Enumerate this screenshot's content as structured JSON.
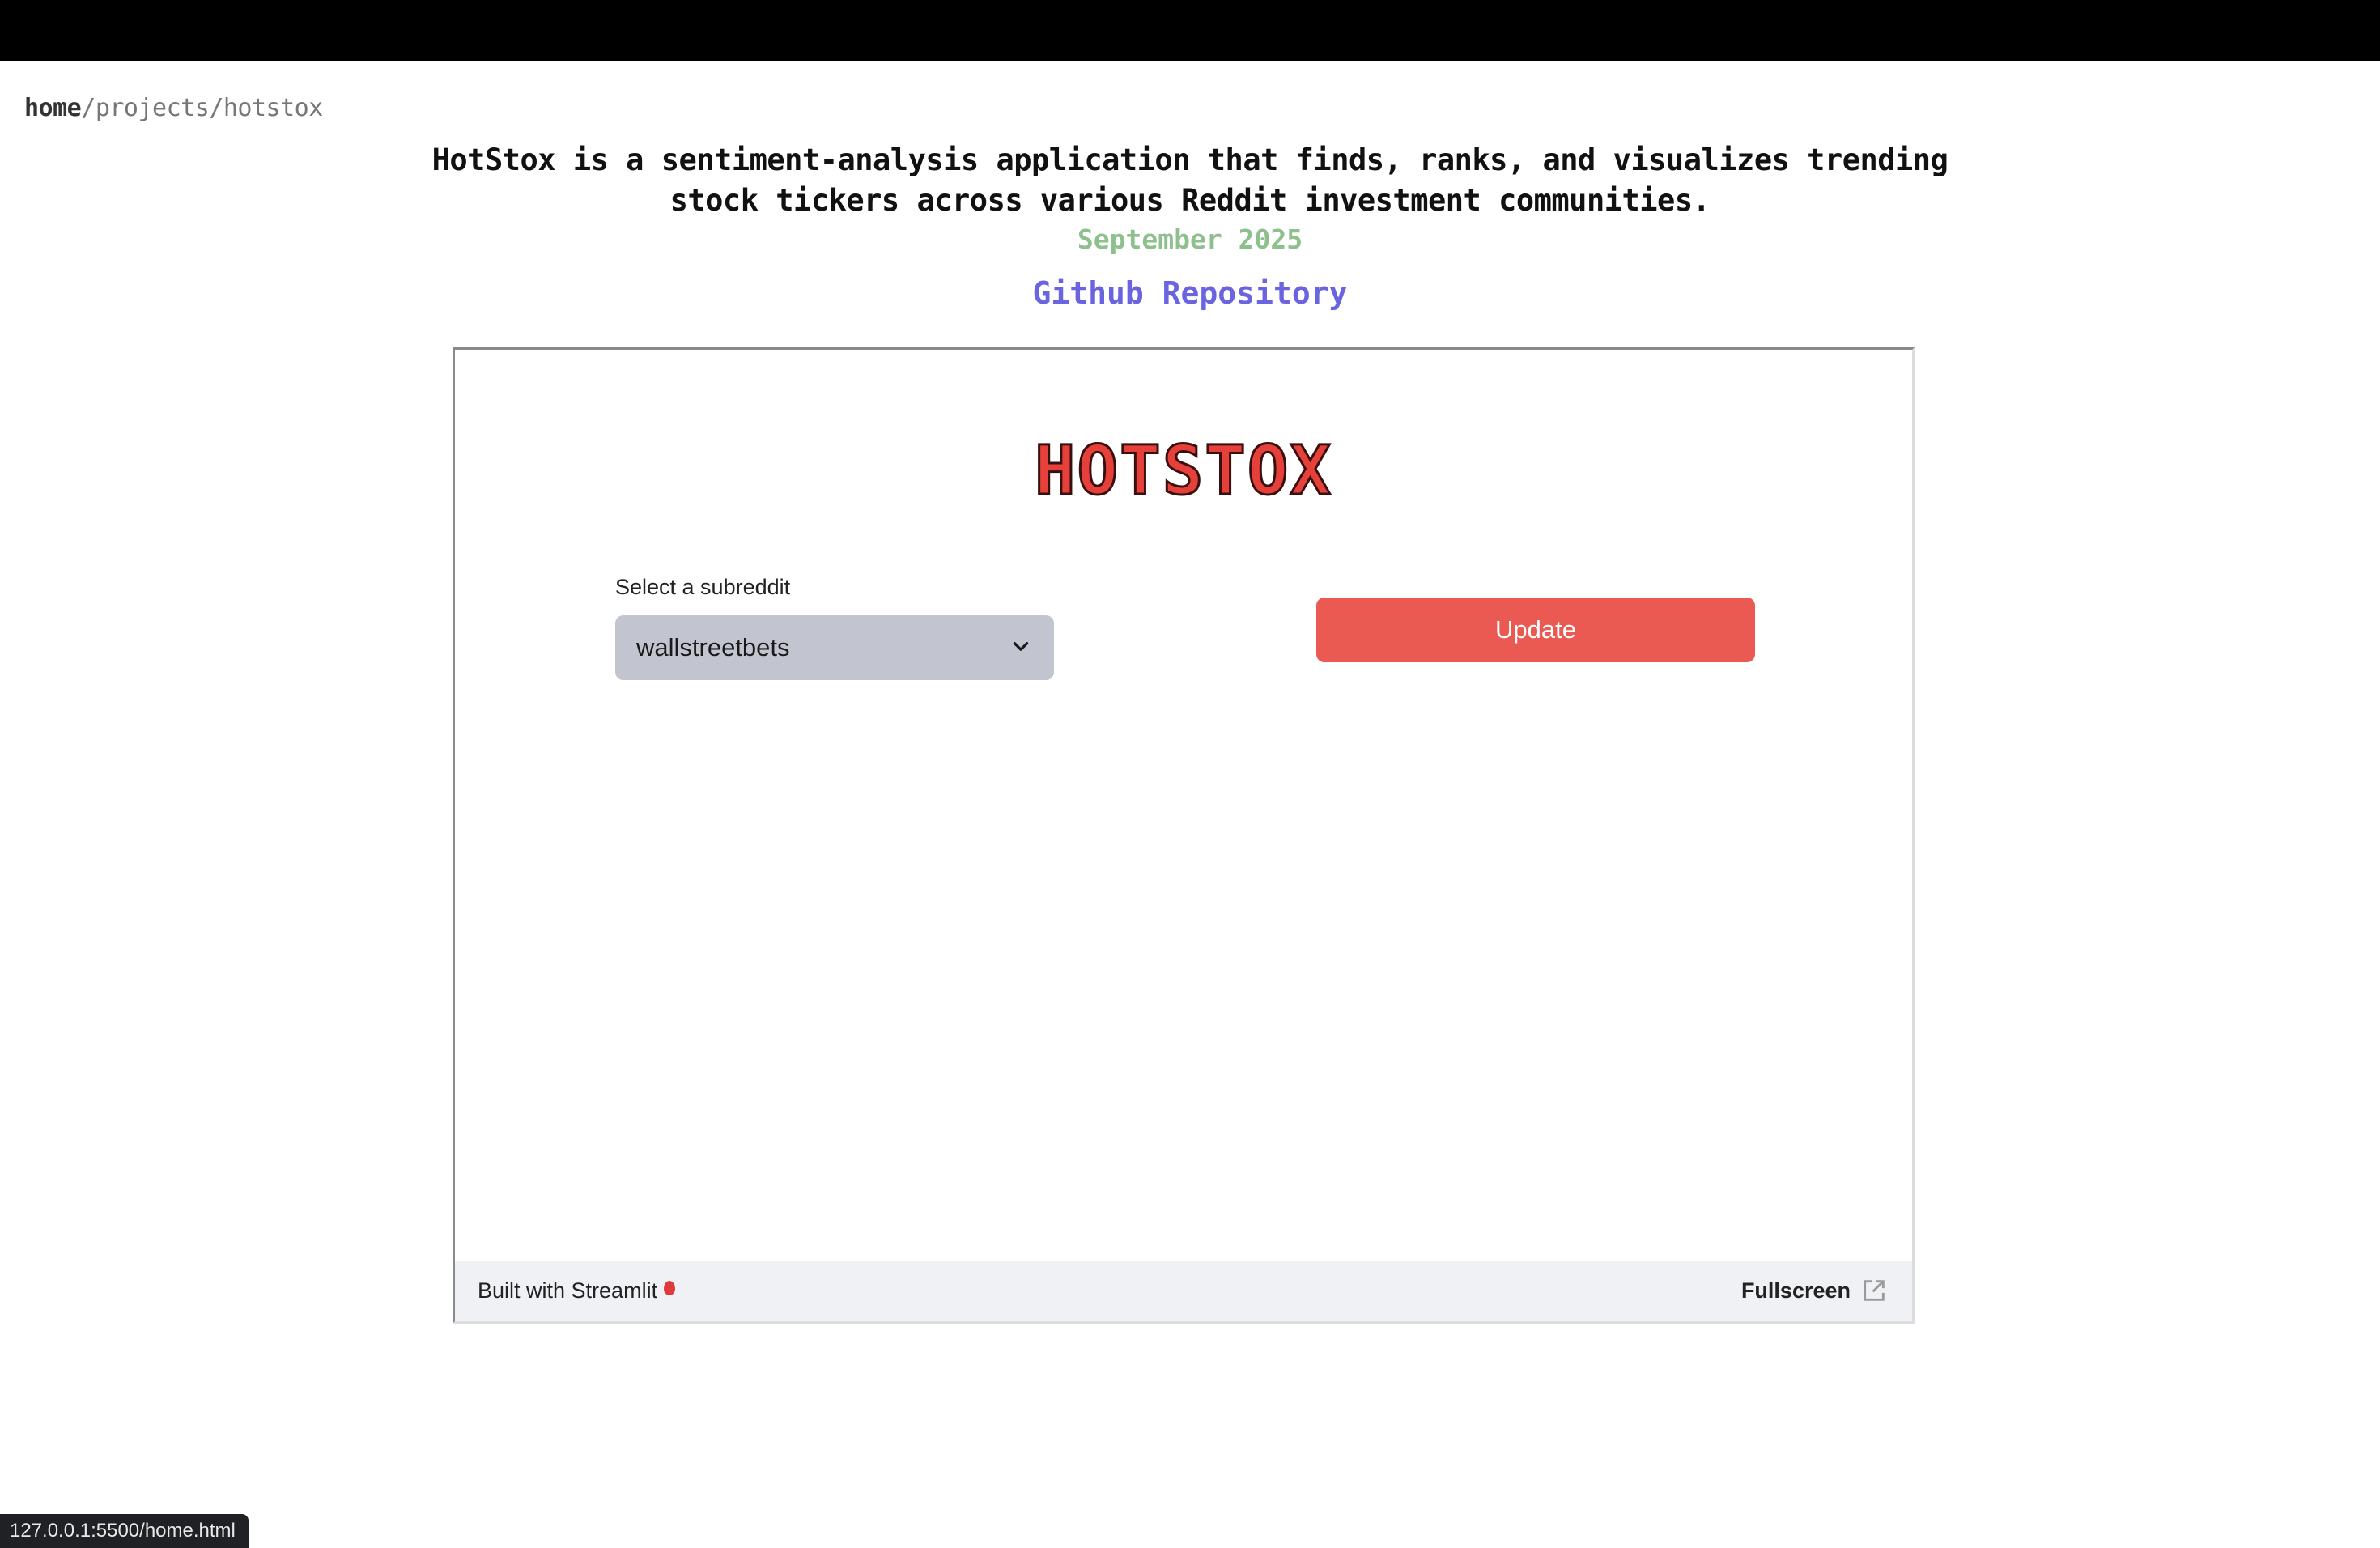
{
  "breadcrumb": {
    "home": "home",
    "sep1": "/",
    "projects": "projects",
    "sep2": "/",
    "current": "hotstox"
  },
  "description": "HotStox is a sentiment-analysis application that finds, ranks, and visualizes trending stock tickers across various Reddit investment communities.",
  "date": "September 2025",
  "repo_link": "Github Repository",
  "app": {
    "logo_text": "HOTSTOX",
    "select_label": "Select a subreddit",
    "select_value": "wallstreetbets",
    "update_button": "Update",
    "footer_built": "Built with Streamlit",
    "footer_fullscreen": "Fullscreen"
  },
  "status_url": "127.0.0.1:5500/home.html",
  "colors": {
    "accent_red": "#ea5a52",
    "date_green": "#8dc08d",
    "link_blue": "#6b64e0"
  },
  "icons": {
    "select_chevron": "chevron-down-icon",
    "fullscreen": "external-link-icon",
    "streamlit": "balloon-icon"
  }
}
